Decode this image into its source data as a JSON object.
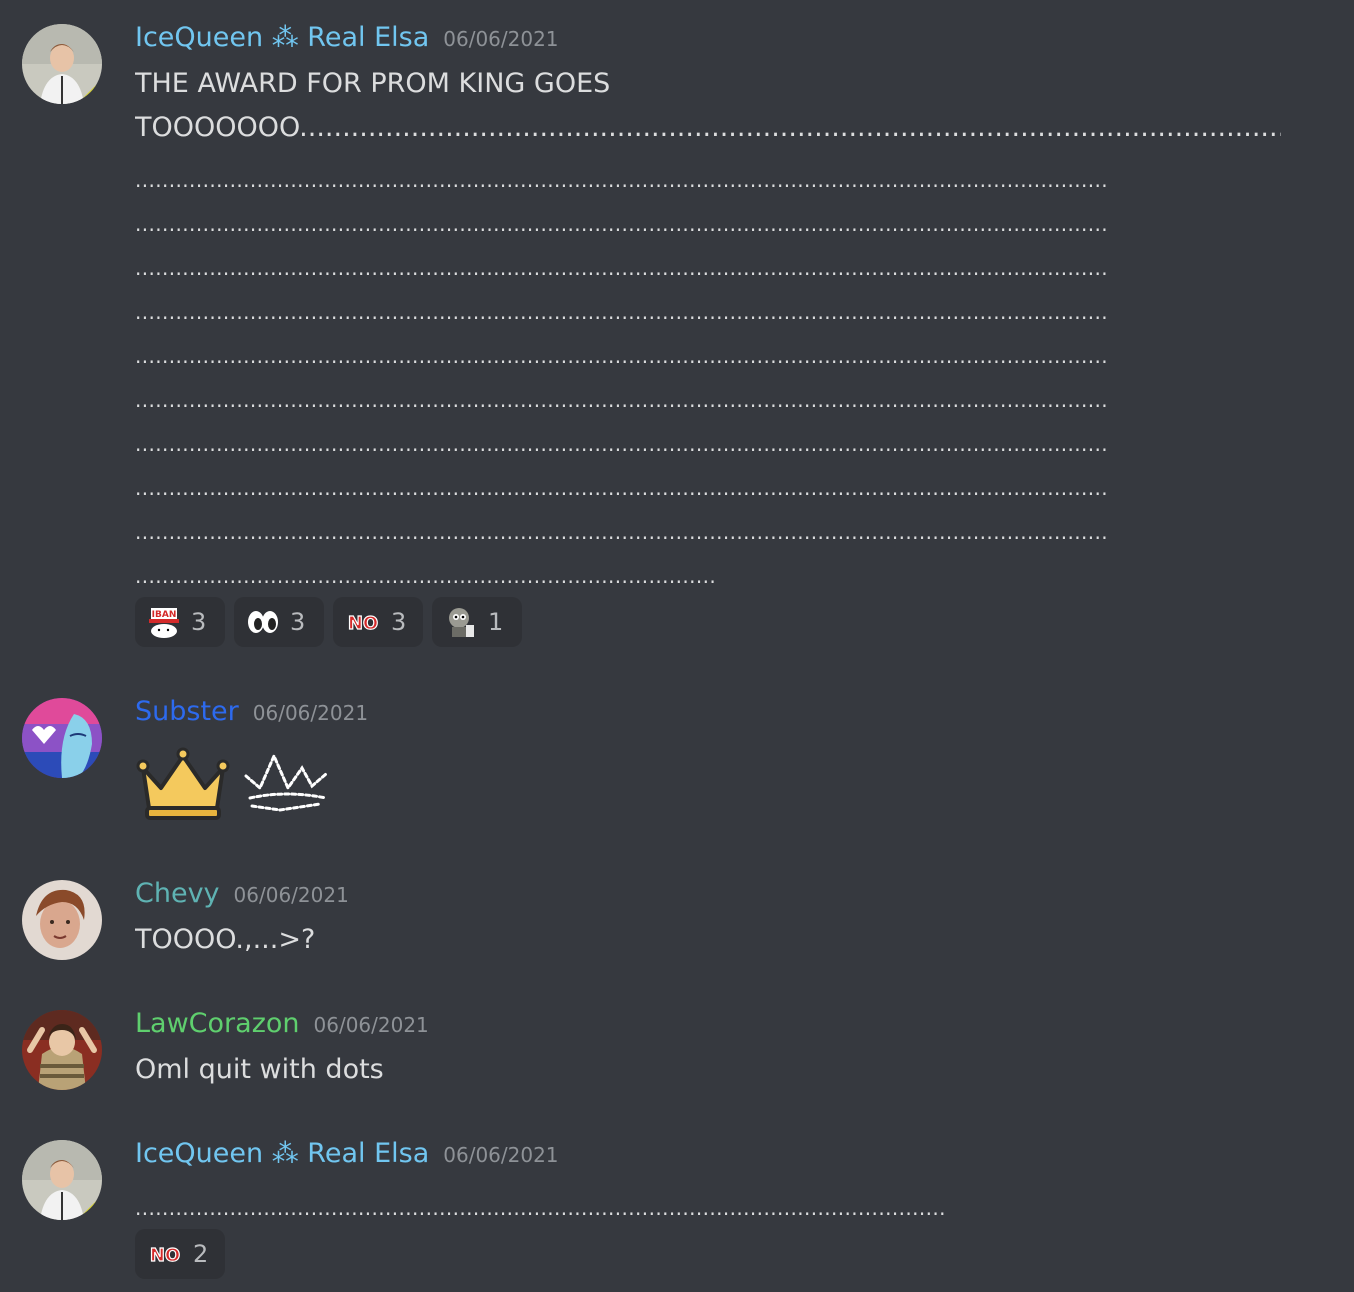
{
  "colors": {
    "background": "#36393f",
    "reaction_bg": "#2f3136",
    "icequeen": "#71c6f0",
    "subster": "#2d6aee",
    "chevy": "#5fb3b3",
    "lawcorazon": "#5fcf6e",
    "timestamp": "#8e9297"
  },
  "messages": [
    {
      "author": "IceQueen ⁂ Real Elsa",
      "timestamp": "06/06/2021",
      "line1": "THE AWARD FOR PROM KING GOES",
      "line2": "TOOOOOOO.........................................................................................................................",
      "dots_lines": [
        "................................................................................................................................................",
        "................................................................................................................................................",
        "................................................................................................................................................",
        "................................................................................................................................................",
        "................................................................................................................................................",
        "................................................................................................................................................",
        "................................................................................................................................................",
        "................................................................................................................................................",
        "................................................................................................................................................",
        "......................................................................................"
      ],
      "reactions": [
        {
          "emoji": "iban-cat-emoji",
          "count": "3"
        },
        {
          "emoji": "eyes-emoji",
          "count": "3"
        },
        {
          "emoji": "no-emoji",
          "count": "3"
        },
        {
          "emoji": "mask-figure-emoji",
          "count": "1"
        }
      ]
    },
    {
      "author": "Subster",
      "timestamp": "06/06/2021",
      "emojis": [
        "crown-emoji",
        "sparkle-crown-emoji"
      ]
    },
    {
      "author": "Chevy",
      "timestamp": "06/06/2021",
      "text": "TOOOO.,...>?"
    },
    {
      "author": "LawCorazon",
      "timestamp": "06/06/2021",
      "text": "Oml quit with dots"
    },
    {
      "author": "IceQueen ⁂ Real Elsa",
      "timestamp": "06/06/2021",
      "text": "........................................................................................................................",
      "reactions": [
        {
          "emoji": "no-emoji",
          "count": "2"
        }
      ]
    }
  ]
}
